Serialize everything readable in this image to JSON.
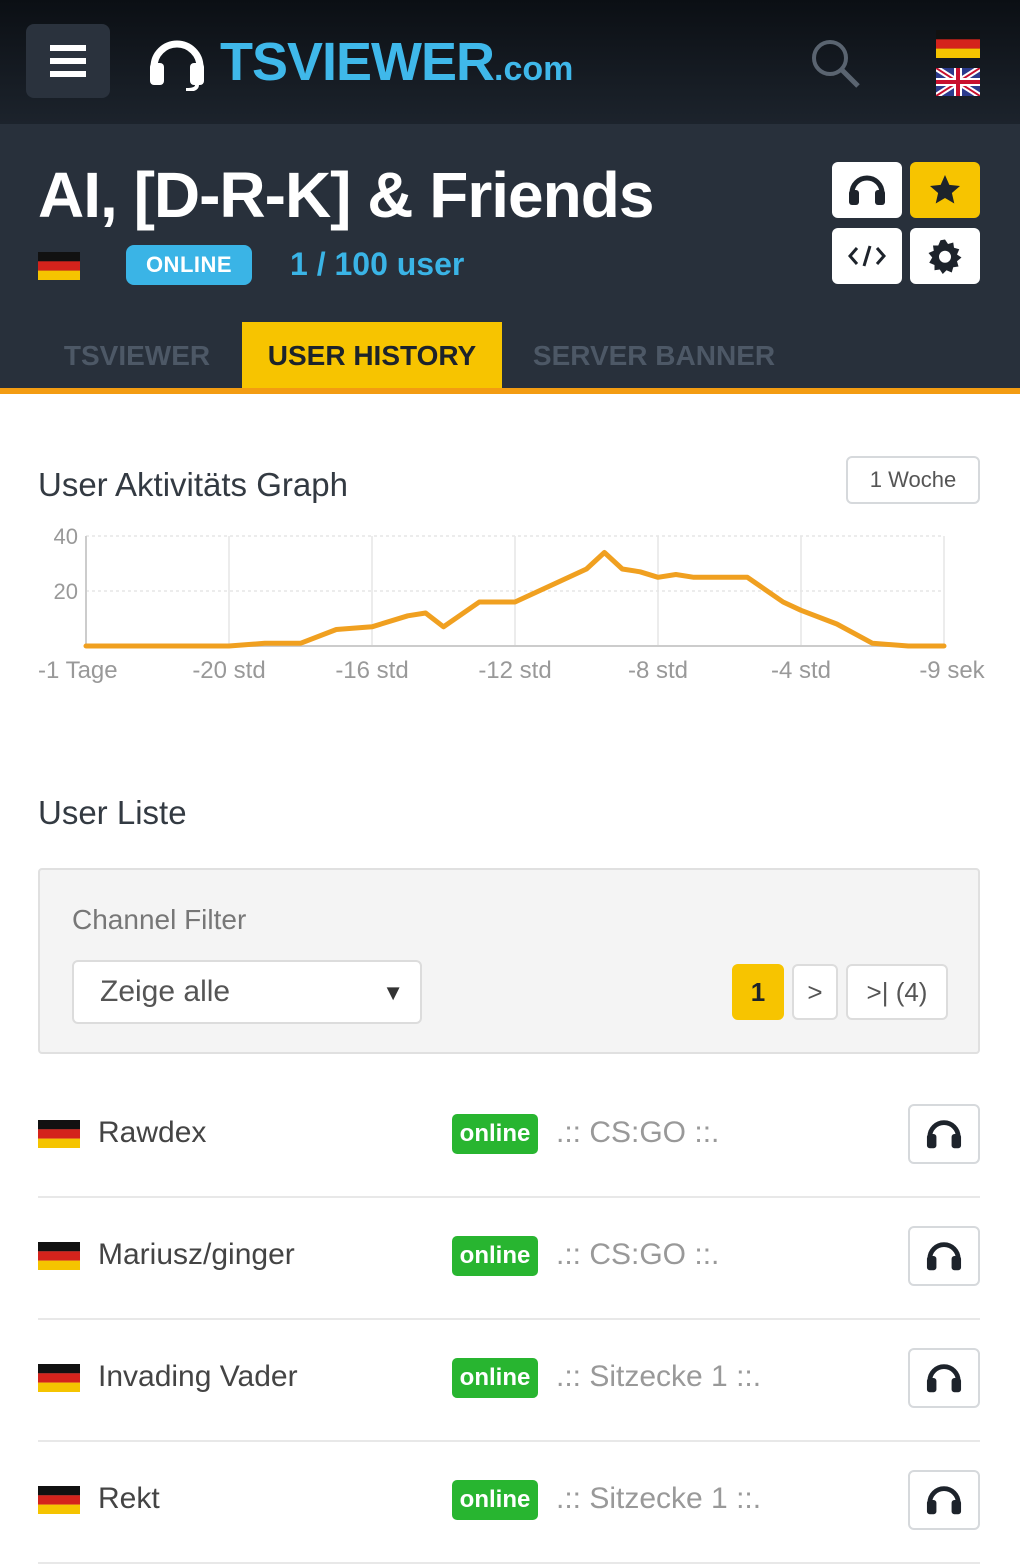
{
  "header": {
    "logo_text": "TSVIEWER",
    "logo_suffix": ".com"
  },
  "server": {
    "title": "AI, [D-R-K] & Friends",
    "status": "ONLINE",
    "user_count": "1 / 100 user"
  },
  "tabs": [
    {
      "label": "TSVIEWER"
    },
    {
      "label": "USER HISTORY"
    },
    {
      "label": "SERVER BANNER"
    }
  ],
  "graph": {
    "title": "User Aktivitäts Graph",
    "range_label": "1 Woche"
  },
  "colors": {
    "accent": "#f7c400",
    "brand": "#3fb8ea",
    "online": "#28b530",
    "line": "#f0a020"
  },
  "chart_data": {
    "type": "line",
    "ylim": [
      0,
      40
    ],
    "y_ticks": [
      "40",
      "20"
    ],
    "x_tick_labels": [
      "-1 Tage",
      "-20 std",
      "-16 std",
      "-12 std",
      "-8 std",
      "-4 std",
      "-9 sek"
    ],
    "x_hours": [
      -24,
      -22,
      -20,
      -19,
      -18,
      -17,
      -16,
      -15,
      -14.5,
      -14,
      -13,
      -12,
      -11,
      -10,
      -9.5,
      -9,
      -8.5,
      -8,
      -7.5,
      -7,
      -6,
      -5.5,
      -4.5,
      -4,
      -3,
      -2,
      -1,
      0
    ],
    "values": [
      0,
      0,
      0,
      1,
      1,
      6,
      7,
      11,
      12,
      7,
      16,
      16,
      22,
      28,
      34,
      28,
      27,
      25,
      26,
      25,
      25,
      25,
      16,
      13,
      8,
      1,
      0,
      0
    ]
  },
  "user_list": {
    "title": "User Liste",
    "filter_label": "Channel Filter",
    "filter_value": "Zeige alle",
    "pagination": [
      {
        "label": "1"
      },
      {
        "label": ">"
      },
      {
        "label": ">| (4)"
      }
    ],
    "users": [
      {
        "name": "Rawdex",
        "status": "online",
        "channel": ".:: CS:GO ::."
      },
      {
        "name": "Mariusz/ginger",
        "status": "online",
        "channel": ".:: CS:GO ::."
      },
      {
        "name": "Invading Vader",
        "status": "online",
        "channel": ".:: Sitzecke 1 ::."
      },
      {
        "name": "Rekt",
        "status": "online",
        "channel": ".:: Sitzecke 1 ::."
      }
    ]
  }
}
